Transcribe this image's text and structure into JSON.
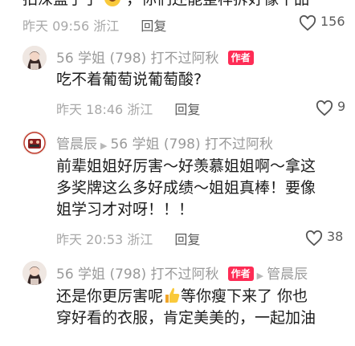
{
  "top_comment": {
    "text_partial": "拍深蓝子了",
    "text_partial_right": "，你们还能整样拆好像十品",
    "time": "昨天 09:56",
    "location": "浙江",
    "reply_label": "回复",
    "likes": "156"
  },
  "comments": [
    {
      "author": "56 学姐 (798) 打不过阿秋",
      "badge": "作者",
      "reply_to": "",
      "lines": [
        "吃不着葡萄说葡萄酸?"
      ],
      "time": "昨天 18:46",
      "location": "浙江",
      "reply_label": "回复",
      "likes": "9"
    },
    {
      "author": "管晨辰",
      "badge": "",
      "reply_to": "56 学姐 (798) 打不过阿秋",
      "lines": [
        "前辈姐姐好厉害～好羡慕姐姐啊～拿这",
        "多奖牌这么多好成绩～姐姐真棒！要像",
        "姐学习才对呀！！！"
      ],
      "time": "昨天 20:53",
      "location": "浙江",
      "reply_label": "回复",
      "likes": "38"
    },
    {
      "author": "56 学姐 (798) 打不过阿秋",
      "badge": "作者",
      "reply_to": "管晨辰",
      "line1_a": "还是你更厉害呢",
      "line1_b": "等你瘦下来了 你也",
      "line2": "穿好看的衣服，肯定美美的，一起加油"
    }
  ],
  "colors": {
    "badge": "#fe2c55",
    "meta": "#a8a8a8",
    "name": "#9a9a9a",
    "text": "#1c1c1c"
  },
  "icons": [
    "heart-outline-icon",
    "thumbs-up-emoji",
    "laughing-emoji"
  ]
}
